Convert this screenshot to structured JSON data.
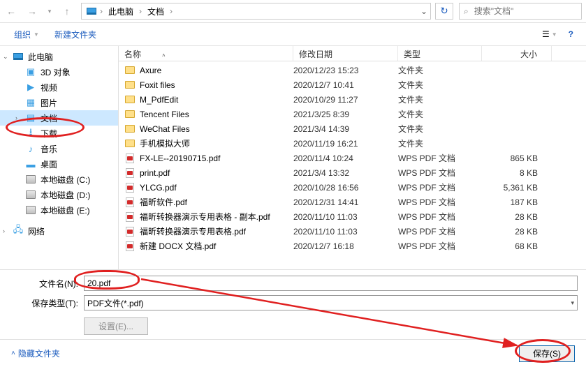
{
  "breadcrumb": {
    "pc_icon": "▣",
    "root": "此电脑",
    "folder": "文档"
  },
  "search": {
    "placeholder": "搜索\"文档\""
  },
  "toolbar": {
    "organize": "组织",
    "new_folder": "新建文件夹"
  },
  "headers": {
    "name": "名称",
    "date": "修改日期",
    "type": "类型",
    "size": "大小"
  },
  "sidebar": {
    "this_pc": "此电脑",
    "objects3d": "3D 对象",
    "videos": "视频",
    "pictures": "图片",
    "documents": "文档",
    "downloads": "下载",
    "music": "音乐",
    "desktop": "桌面",
    "drive_c": "本地磁盘 (C:)",
    "drive_d": "本地磁盘 (D:)",
    "drive_e": "本地磁盘 (E:)",
    "network": "网络"
  },
  "files": [
    {
      "name": "Axure",
      "date": "2020/12/23 15:23",
      "type": "文件夹",
      "size": "",
      "kind": "folder"
    },
    {
      "name": "Foxit files",
      "date": "2020/12/7 10:41",
      "type": "文件夹",
      "size": "",
      "kind": "folder"
    },
    {
      "name": "M_PdfEdit",
      "date": "2020/10/29 11:27",
      "type": "文件夹",
      "size": "",
      "kind": "folder"
    },
    {
      "name": "Tencent Files",
      "date": "2021/3/25 8:39",
      "type": "文件夹",
      "size": "",
      "kind": "folder"
    },
    {
      "name": "WeChat Files",
      "date": "2021/3/4 14:39",
      "type": "文件夹",
      "size": "",
      "kind": "folder"
    },
    {
      "name": "手机模拟大师",
      "date": "2020/11/19 16:21",
      "type": "文件夹",
      "size": "",
      "kind": "folder"
    },
    {
      "name": "FX-LE--20190715.pdf",
      "date": "2020/11/4 10:24",
      "type": "WPS PDF 文档",
      "size": "865 KB",
      "kind": "pdf"
    },
    {
      "name": "print.pdf",
      "date": "2021/3/4 13:32",
      "type": "WPS PDF 文档",
      "size": "8 KB",
      "kind": "pdf"
    },
    {
      "name": "YLCG.pdf",
      "date": "2020/10/28 16:56",
      "type": "WPS PDF 文档",
      "size": "5,361 KB",
      "kind": "pdf"
    },
    {
      "name": "福昕软件.pdf",
      "date": "2020/12/31 14:41",
      "type": "WPS PDF 文档",
      "size": "187 KB",
      "kind": "pdf"
    },
    {
      "name": "福昕转换器演示专用表格 - 副本.pdf",
      "date": "2020/11/10 11:03",
      "type": "WPS PDF 文档",
      "size": "28 KB",
      "kind": "pdf"
    },
    {
      "name": "福昕转换器演示专用表格.pdf",
      "date": "2020/11/10 11:03",
      "type": "WPS PDF 文档",
      "size": "28 KB",
      "kind": "pdf"
    },
    {
      "name": "新建 DOCX 文档.pdf",
      "date": "2020/12/7 16:18",
      "type": "WPS PDF 文档",
      "size": "68 KB",
      "kind": "pdf"
    }
  ],
  "fields": {
    "filename_label": "文件名(N):",
    "filename_value": "20.pdf",
    "type_label": "保存类型(T):",
    "type_value": "PDF文件(*.pdf)",
    "options_btn": "设置(E)..."
  },
  "footer": {
    "hide_folders": "隐藏文件夹",
    "save": "保存(S)"
  }
}
